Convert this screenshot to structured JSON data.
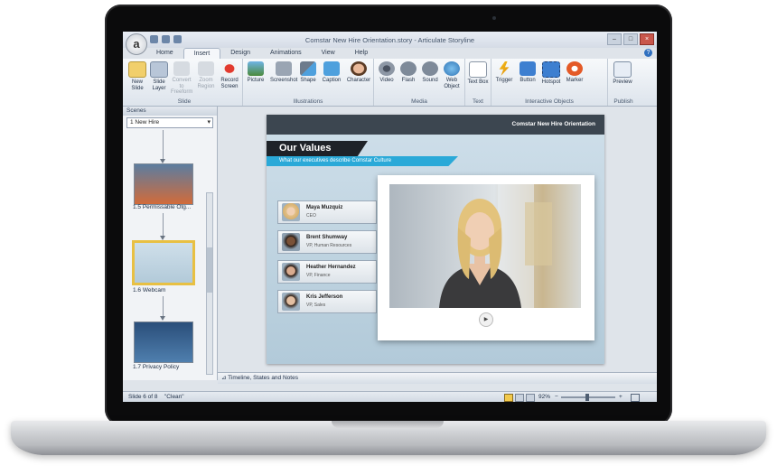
{
  "window": {
    "title": "Comstar New Hire Orientation.story - Articulate Storyline",
    "logo_letter": "a"
  },
  "tabs": [
    "Home",
    "Insert",
    "Design",
    "Animations",
    "View",
    "Help"
  ],
  "active_tab": "Insert",
  "ribbon": {
    "slide": {
      "label": "Slide",
      "buttons": [
        "New Slide",
        "Slide Layer",
        "Convert to Freeform",
        "Zoom Region",
        "Record Screen"
      ]
    },
    "illustrations": {
      "label": "Illustrations",
      "buttons": [
        "Picture",
        "Screenshot",
        "Shape",
        "Caption",
        "Character"
      ]
    },
    "media": {
      "label": "Media",
      "buttons": [
        "Video",
        "Flash",
        "Sound",
        "Web Object"
      ]
    },
    "text": {
      "label": "Text",
      "buttons": [
        "Text Box"
      ]
    },
    "interactive": {
      "label": "Interactive Objects",
      "buttons": [
        "Trigger",
        "Button",
        "Hotspot",
        "Marker"
      ]
    },
    "publish": {
      "label": "Publish",
      "buttons": [
        "Preview"
      ]
    }
  },
  "pane": {
    "header": "Scenes",
    "scene_select": "1 New Hire",
    "slides": [
      "1.5 Permissable Otg...",
      "1.6 Webcam",
      "1.7 Privacy Policy"
    ]
  },
  "slide": {
    "header": "Comstar New Hire Orientation",
    "title": "Our Values",
    "subtitle": "What our executives describe Comstar Culture",
    "people": [
      {
        "name": "Maya Muzquiz",
        "role": "CEO"
      },
      {
        "name": "Brent Shumway",
        "role": "VP, Human Resources"
      },
      {
        "name": "Heather Hernandez",
        "role": "VP, Finance"
      },
      {
        "name": "Kris Jefferson",
        "role": "VP, Sales"
      }
    ],
    "play_symbol": "▶"
  },
  "timeline_label": "Timeline, States and Notes",
  "status": {
    "slide_info": "Slide 6 of 8",
    "theme": "\"Clean\"",
    "zoom": "92%"
  },
  "colors": {
    "accent": "#2aa9d8",
    "slide_header": "#3c4650",
    "selected_thumb": "#e8c043"
  }
}
